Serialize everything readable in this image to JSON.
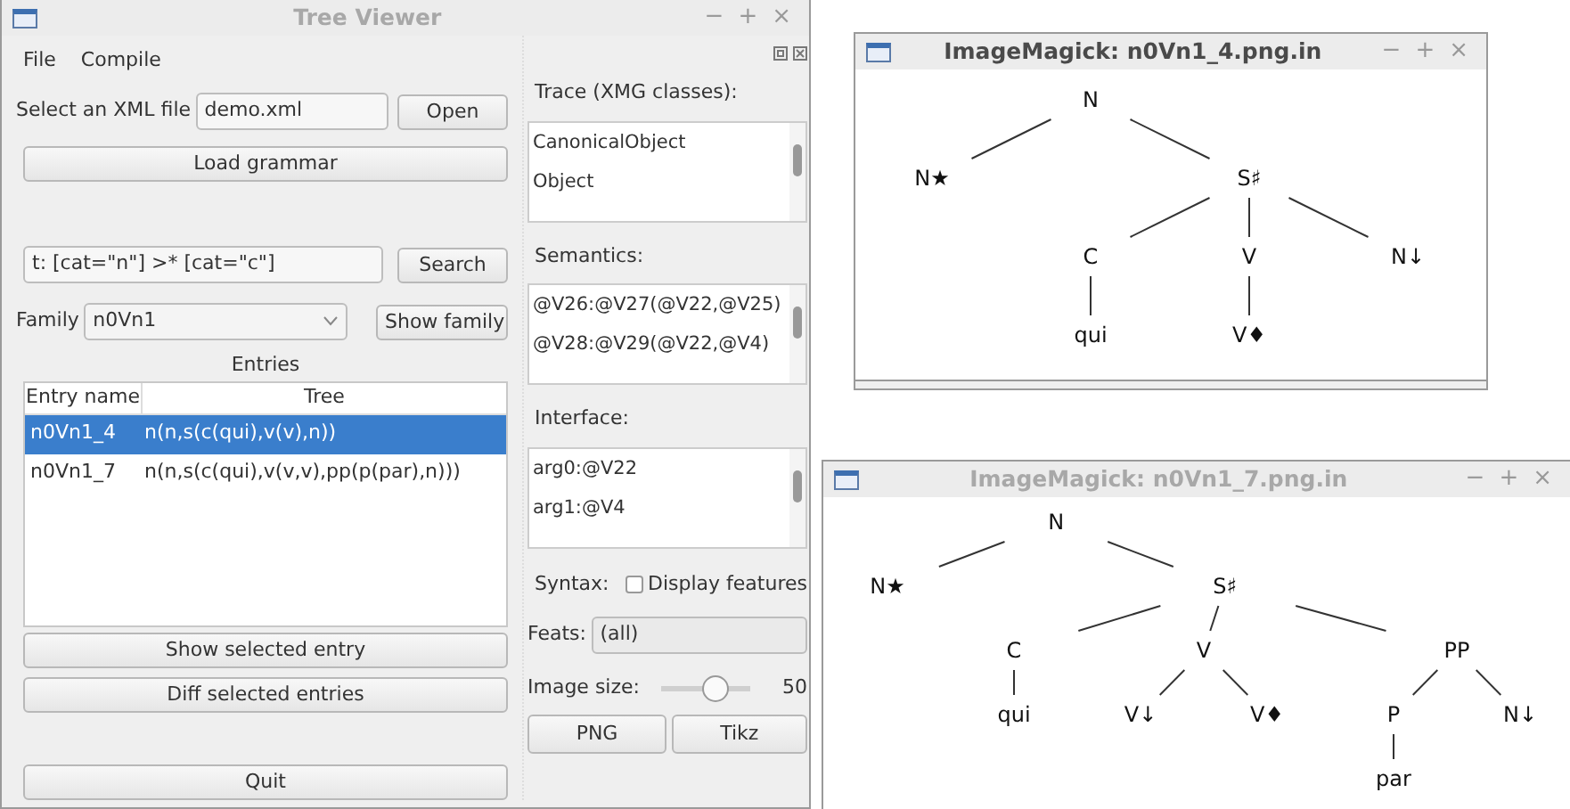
{
  "main_window": {
    "title": "Tree Viewer",
    "active": false,
    "controls": [
      "−",
      "+",
      "×"
    ],
    "menu": [
      "File",
      "Compile"
    ],
    "file_label": "Select an XML file",
    "file_value": "demo.xml",
    "open_button": "Open",
    "load_button": "Load grammar",
    "query_value": "t: [cat=\"n\"] >* [cat=\"c\"]",
    "search_button": "Search",
    "family_label": "Family",
    "family_value": "n0Vn1",
    "show_family_button": "Show family",
    "entries": {
      "title": "Entries",
      "columns": [
        "Entry name",
        "Tree"
      ],
      "rows": [
        {
          "cells": [
            "n0Vn1_4",
            "n(n,s(c(qui),v(v),n))"
          ],
          "selected": true
        },
        {
          "cells": [
            "n0Vn1_7",
            "n(n,s(c(qui),v(v,v),pp(p(par),n)))"
          ],
          "selected": false
        }
      ]
    },
    "show_entry_button": "Show selected entry",
    "diff_button": "Diff selected entries",
    "quit_button": "Quit",
    "dock": {
      "lists": [
        {
          "label": "Trace (XMG classes):",
          "items": [
            "CanonicalObject",
            "Object"
          ]
        },
        {
          "label": "Semantics:",
          "items": [
            "@V26:@V27(@V22,@V25)",
            "@V28:@V29(@V22,@V4)"
          ]
        },
        {
          "label": "Interface:",
          "items": [
            "arg0:@V22",
            "arg1:@V4"
          ]
        }
      ],
      "syntax_label": "Syntax:",
      "display_features": {
        "label": "Display features",
        "checked": false
      },
      "feats_label": "Feats:",
      "feats_value": "(all)",
      "image_size": {
        "label": "Image size:",
        "level": 0.6,
        "reading": "50"
      },
      "buttons": [
        "PNG",
        "Tikz"
      ]
    }
  },
  "viewers": [
    {
      "title": "ImageMagick: n0Vn1_4.png.in",
      "active": true,
      "controls": [
        "−",
        "+",
        "×"
      ],
      "tree": {
        "label": "N",
        "children": [
          {
            "label": "N★"
          },
          {
            "label": "S♯",
            "children": [
              {
                "label": "C",
                "children": [
                  {
                    "label": "qui"
                  }
                ]
              },
              {
                "label": "V",
                "children": [
                  {
                    "label": "V♦"
                  }
                ]
              },
              {
                "label": "N↓"
              }
            ]
          }
        ]
      }
    },
    {
      "title": "ImageMagick: n0Vn1_7.png.in",
      "active": false,
      "controls": [
        "−",
        "+",
        "×"
      ],
      "tree": {
        "label": "N",
        "children": [
          {
            "label": "N★"
          },
          {
            "label": "S♯",
            "children": [
              {
                "label": "C",
                "children": [
                  {
                    "label": "qui"
                  }
                ]
              },
              {
                "label": "V",
                "children": [
                  {
                    "label": "V↓"
                  },
                  {
                    "label": "V♦"
                  }
                ]
              },
              {
                "label": "PP",
                "children": [
                  {
                    "label": "P",
                    "children": [
                      {
                        "label": "par"
                      }
                    ]
                  },
                  {
                    "label": "N↓"
                  }
                ]
              }
            ]
          }
        ]
      }
    }
  ]
}
